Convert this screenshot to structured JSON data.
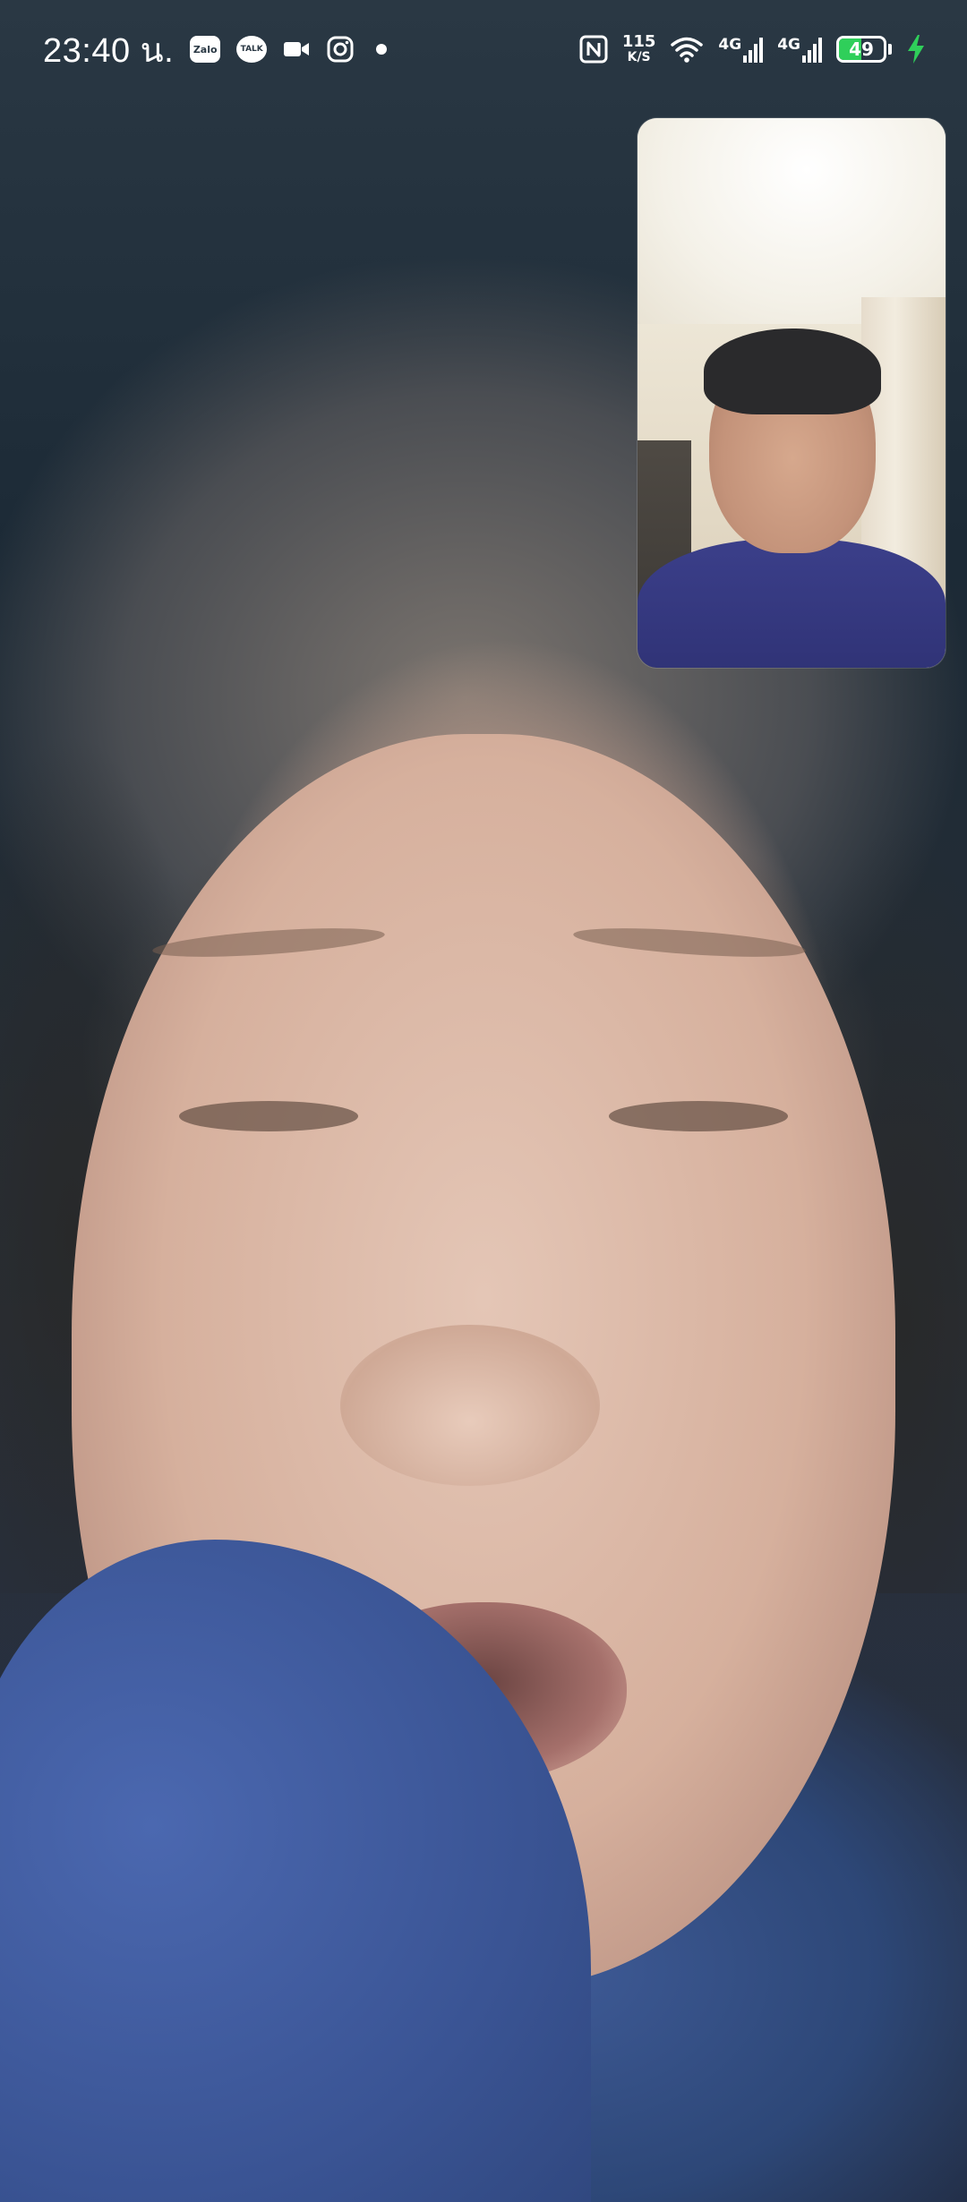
{
  "status_bar": {
    "time": "23:40 น.",
    "notification_icons": [
      {
        "name": "zalo-icon",
        "label": "Zalo"
      },
      {
        "name": "kakaotalk-icon",
        "label": "TALK"
      },
      {
        "name": "video-camera-icon"
      },
      {
        "name": "instagram-icon"
      },
      {
        "name": "more-notifications-dot-icon"
      }
    ],
    "nfc_icon": "nfc-icon",
    "network_speed": {
      "value": "115",
      "unit": "K/S"
    },
    "wifi_icon": "wifi-icon",
    "sim1": {
      "label": "4G",
      "signal_fraction": 1.0
    },
    "sim2": {
      "label": "4G",
      "signal_fraction": 1.0
    },
    "battery": {
      "level": "49",
      "fraction": 0.49,
      "charging": true,
      "fill_color": "#2fcf5a",
      "bolt_color": "#2fcf5a"
    }
  },
  "call": {
    "remote_video": "remote-participant-video",
    "self_preview": "self-camera-preview"
  }
}
